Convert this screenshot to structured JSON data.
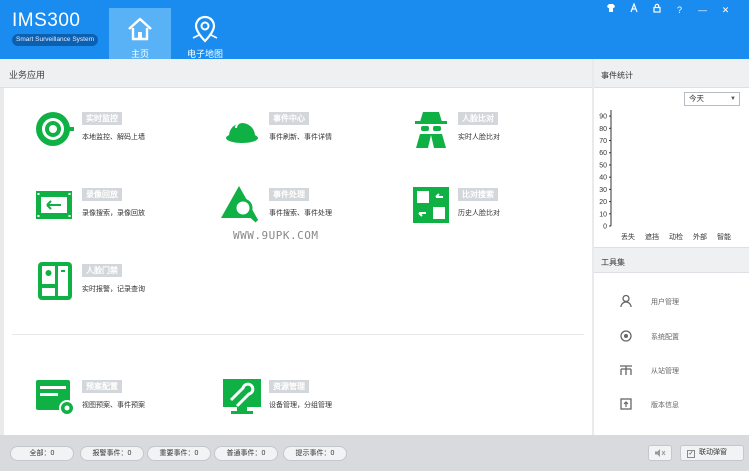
{
  "app": {
    "title": "IMS300",
    "subtitle": "Smart Surveillance System"
  },
  "nav": [
    {
      "label": "主页",
      "icon": "home-icon",
      "active": true
    },
    {
      "label": "电子地图",
      "icon": "map-pin-icon",
      "active": false
    }
  ],
  "window_controls": [
    "shirt-icon",
    "font-icon",
    "lock-icon",
    "?",
    "—",
    "✕"
  ],
  "left_panel": {
    "title": "业务应用"
  },
  "apps": [
    {
      "name": "实时监控",
      "desc": "本地监控、解码上墙",
      "icon": "camera-eye-icon"
    },
    {
      "name": "事件中心",
      "desc": "事件刷新、事件详情",
      "icon": "alarm-light-icon"
    },
    {
      "name": "人脸比对",
      "desc": "实时人脸比对",
      "icon": "spy-face-icon"
    },
    {
      "name": "录像回放",
      "desc": "录像搜索，录像回放",
      "icon": "film-playback-icon"
    },
    {
      "name": "事件处理",
      "desc": "事件搜索、事件处理",
      "icon": "event-search-icon"
    },
    {
      "name": "比对搜索",
      "desc": "历史人脸比对",
      "icon": "compare-icon"
    },
    {
      "name": "人脸门禁",
      "desc": "实时报警，记录查询",
      "icon": "access-device-icon"
    },
    {
      "name": "预案配置",
      "desc": "视图预案、事件预案",
      "icon": "plan-config-icon"
    },
    {
      "name": "资源管理",
      "desc": "设备管理，分组管理",
      "icon": "resource-tool-icon"
    }
  ],
  "watermark": "WWW.9UPK.COM",
  "event_stats": {
    "title": "事件统计",
    "period": "今天",
    "period_caret": "▼"
  },
  "chart_data": {
    "type": "bar",
    "categories": [
      "丢失",
      "遮挡",
      "动检",
      "外部",
      "智能"
    ],
    "values": [
      0,
      0,
      0,
      0,
      0
    ],
    "ylim": [
      0,
      95
    ],
    "yticks": [
      "0",
      "10",
      "20",
      "30",
      "40",
      "50",
      "60",
      "70",
      "80",
      "90"
    ]
  },
  "toolbox": {
    "title": "工具集",
    "items": [
      {
        "label": "用户管理",
        "icon": "user-icon"
      },
      {
        "label": "系统配置",
        "icon": "settings-icon"
      },
      {
        "label": "从站管理",
        "icon": "sub-station-icon"
      },
      {
        "label": "版本信息",
        "icon": "info-icon"
      }
    ]
  },
  "status_bar": {
    "counters": [
      {
        "label": "全部：",
        "count": "0"
      },
      {
        "label": "报警事件：",
        "count": "0"
      },
      {
        "label": "重要事件：",
        "count": "0"
      },
      {
        "label": "普通事件：",
        "count": "0"
      },
      {
        "label": "提示事件：",
        "count": "0"
      }
    ],
    "link_label": "联动弹窗",
    "check_mark": "✓",
    "mute_icon": "speaker-mute-icon"
  },
  "colors": {
    "header": "#1a8cf0",
    "nav_active": "#5ab2f6",
    "icon_green": "#0fb145",
    "app_label_bg": "#d3d6da"
  }
}
